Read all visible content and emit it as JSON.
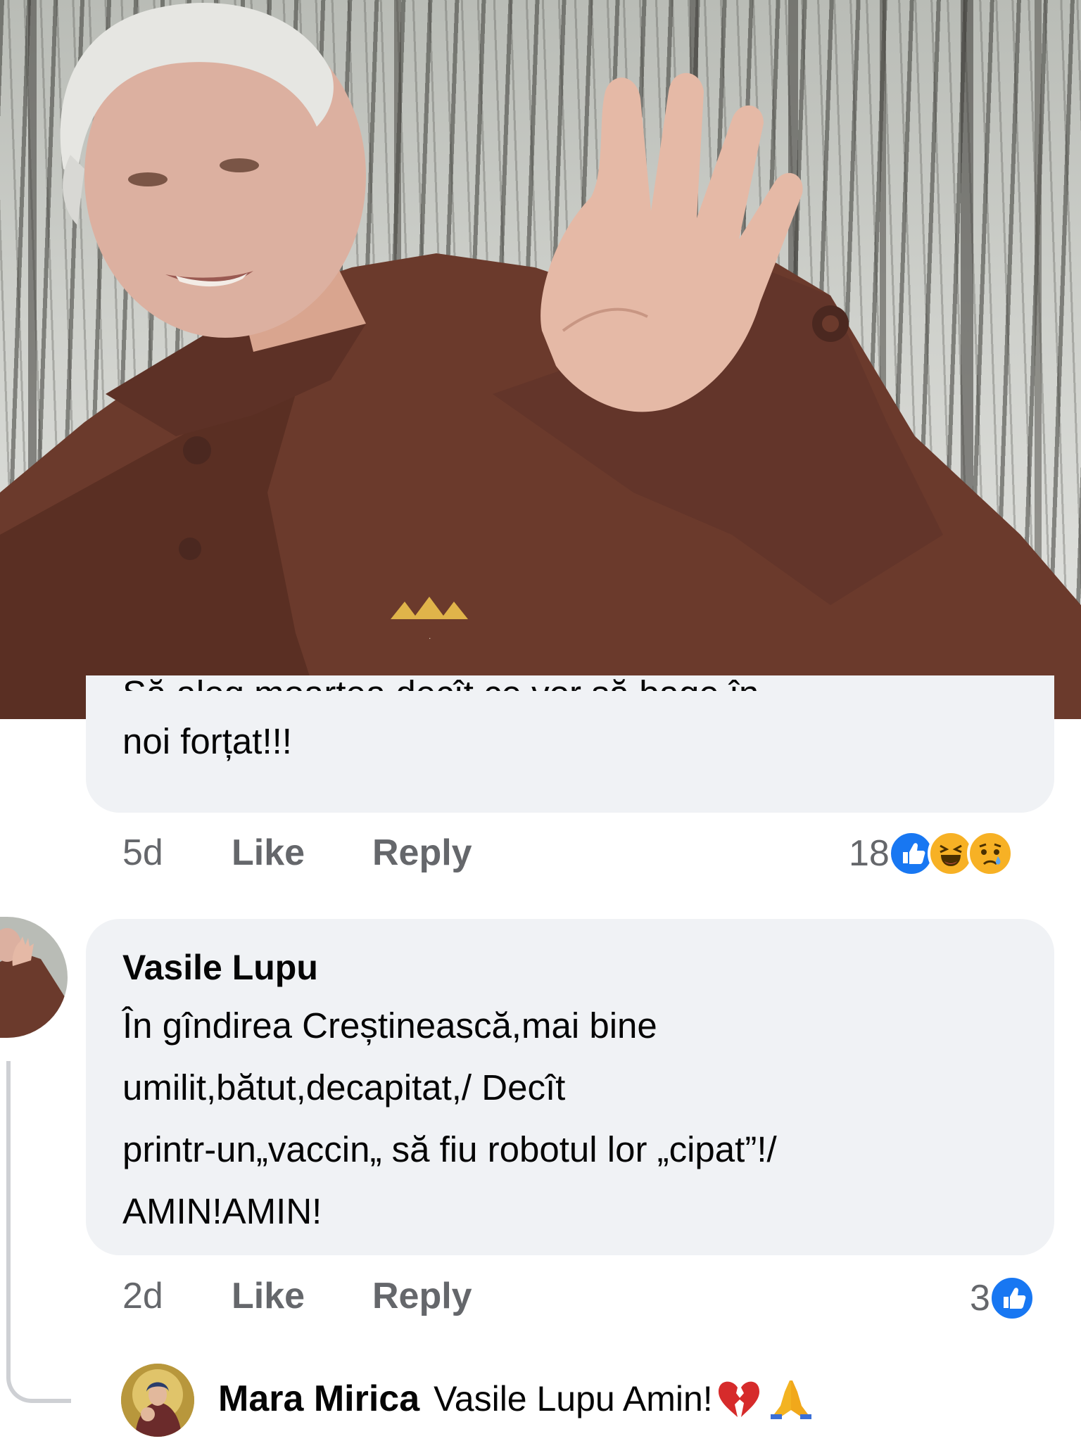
{
  "photo": {
    "logo_text": "."
  },
  "comment_top": {
    "text_cut": "Să aleg moartea decît ce vor să bage în",
    "text": "noi forțat!!!",
    "time": "5d",
    "like_label": "Like",
    "reply_label": "Reply",
    "reaction_count": "18",
    "reactions": [
      "like-icon",
      "haha-icon",
      "sad-icon"
    ]
  },
  "comment_vasile": {
    "author": "Vasile Lupu",
    "lines": [
      "În gîndirea Creștinească,mai bine",
      "umilit,bătut,decapitat,/ Decît",
      "printr-un„vaccin„ să fiu robotul lor „cipat”!/",
      "AMIN!AMIN!"
    ],
    "time": "2d",
    "like_label": "Like",
    "reply_label": "Reply",
    "reaction_count": "3",
    "reactions": [
      "like-icon"
    ]
  },
  "reply_mara": {
    "author": "Mara Mirica",
    "text": "Vasile Lupu Amin!",
    "emojis": [
      "broken-heart-icon",
      "praying-hands-icon"
    ]
  },
  "colors": {
    "bubble": "#f0f2f5",
    "meta": "#65676b",
    "like_blue": "#1877f2",
    "coat_brown": "#6b3a2c"
  }
}
